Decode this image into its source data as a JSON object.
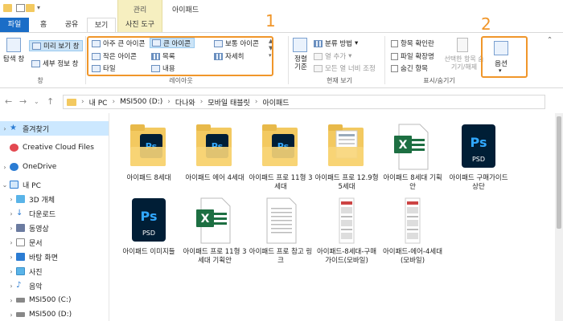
{
  "window": {
    "context_group": "관리",
    "title": "아이패드"
  },
  "tabs": {
    "file": "파일",
    "home": "홈",
    "share": "공유",
    "view": "보기",
    "photo_tools": "사진 도구"
  },
  "ribbon": {
    "panes": {
      "nav_pane": "탐색 창",
      "preview_pane": "미리 보기 창",
      "details_pane": "세부 정보 창",
      "label": "창"
    },
    "layout": {
      "extra_large": "아주 큰 아이콘",
      "large": "큰 아이콘",
      "medium": "보통 아이콘",
      "small": "작은 아이콘",
      "list": "목록",
      "details": "자세히",
      "tiles": "타일",
      "content": "내용",
      "label": "레이아웃"
    },
    "current_view": {
      "sort_by": "정렬 기준",
      "group_by": "분류 방법",
      "add_columns": "열 추가",
      "size_all_columns": "모든 열 너비 조정",
      "label": "현재 보기"
    },
    "show_hide": {
      "item_checkboxes": "항목 확인란",
      "file_extensions": "파일 확장명",
      "hidden_items": "숨긴 항목",
      "hide_selected": "선택한 항목 숨기기/해제",
      "label": "표시/숨기기"
    },
    "options": "옵션",
    "callout_1": "1",
    "callout_2": "2"
  },
  "address": {
    "crumbs": [
      "내 PC",
      "MSI500 (D:)",
      "다나와",
      "모바일 태블릿",
      "아이패드"
    ]
  },
  "nav": [
    {
      "label": "즐겨찾기",
      "expand": "›",
      "selected": true
    },
    {
      "label": "Creative Cloud Files",
      "expand": "",
      "selected": false
    },
    {
      "label": "OneDrive",
      "expand": "›",
      "selected": false
    },
    {
      "label": "내 PC",
      "expand": "⌄",
      "selected": false
    },
    {
      "label": "3D 개체",
      "expand": "›",
      "selected": false
    },
    {
      "label": "다운로드",
      "expand": "›",
      "selected": false
    },
    {
      "label": "동영상",
      "expand": "›",
      "selected": false
    },
    {
      "label": "문서",
      "expand": "›",
      "selected": false
    },
    {
      "label": "바탕 화면",
      "expand": "›",
      "selected": false
    },
    {
      "label": "사진",
      "expand": "›",
      "selected": false
    },
    {
      "label": "음악",
      "expand": "›",
      "selected": false
    },
    {
      "label": "MSI500 (C:)",
      "expand": "›",
      "selected": false
    },
    {
      "label": "MSI500 (D:)",
      "expand": "›",
      "selected": false
    }
  ],
  "files": [
    {
      "name": "아이패드 8세대",
      "type": "folder-psd"
    },
    {
      "name": "아이패드 에어 4세대",
      "type": "folder-psd"
    },
    {
      "name": "아이패드 프로 11형 3세대",
      "type": "folder-psd"
    },
    {
      "name": "아이패드 프로 12.9형 5세대",
      "type": "folder-doc"
    },
    {
      "name": "아이패드 8세대 기획안",
      "type": "excel"
    },
    {
      "name": "아이패드 구매가이드 상단",
      "type": "psd"
    },
    {
      "name": "아이패드 이미지들",
      "type": "psd"
    },
    {
      "name": "아이패드 프로 11형 3세대 기획안",
      "type": "excel"
    },
    {
      "name": "아이패드 프로 참고 링크",
      "type": "text"
    },
    {
      "name": "아이패드-8세대-구매가이드(모바일)",
      "type": "image"
    },
    {
      "name": "아이패드-에어-4세대(모바일)",
      "type": "image"
    }
  ],
  "colors": {
    "accent": "#1a6dc7",
    "callout": "#f0962a",
    "psd_bg": "#001e36",
    "psd_text": "#31a8ff",
    "excel": "#1d6f42",
    "folder": "#f3c960"
  }
}
